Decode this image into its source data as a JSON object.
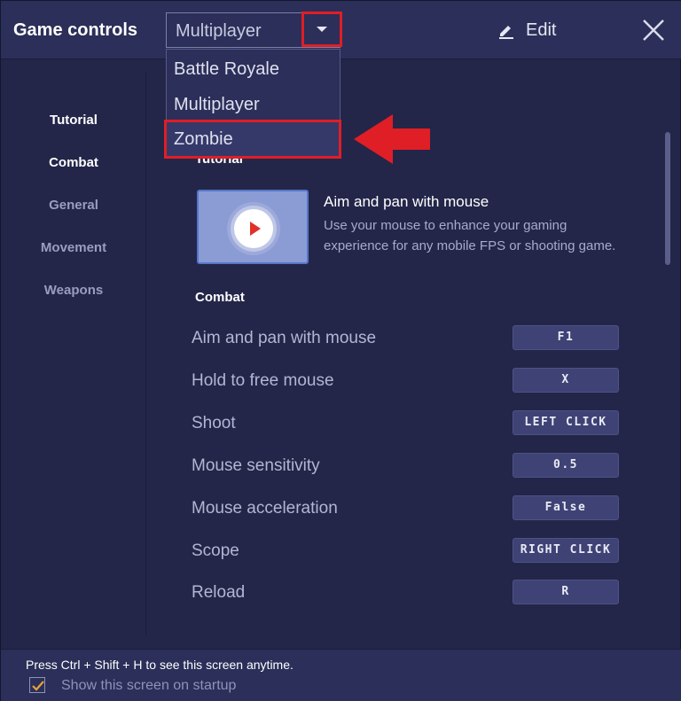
{
  "header": {
    "title": "Game controls",
    "mode_selected": "Multiplayer",
    "edit_label": "Edit"
  },
  "dropdown": {
    "options": [
      "Battle Royale",
      "Multiplayer",
      "Zombie"
    ],
    "highlighted": "Zombie"
  },
  "sidebar": {
    "items": [
      {
        "label": "Tutorial",
        "active": true
      },
      {
        "label": "Combat",
        "active": true
      },
      {
        "label": "General",
        "active": false
      },
      {
        "label": "Movement",
        "active": false
      },
      {
        "label": "Weapons",
        "active": false
      }
    ]
  },
  "tutorial": {
    "heading": "Tutorial",
    "card_title": "Aim and pan with mouse",
    "card_desc": "Use your mouse to enhance your gaming experience for any mobile FPS or shooting game."
  },
  "combat": {
    "heading": "Combat",
    "controls": [
      {
        "label": "Aim and pan with mouse",
        "key": "F1"
      },
      {
        "label": "Hold to free mouse",
        "key": "X"
      },
      {
        "label": "Shoot",
        "key": "LEFT CLICK"
      },
      {
        "label": "Mouse sensitivity",
        "key": "0.5"
      },
      {
        "label": "Mouse acceleration",
        "key": "False"
      },
      {
        "label": "Scope",
        "key": "RIGHT CLICK"
      },
      {
        "label": "Reload",
        "key": "R"
      }
    ]
  },
  "footer": {
    "hint": "Press Ctrl + Shift + H to see this screen anytime.",
    "startup_label": "Show this screen on startup",
    "startup_checked": true
  },
  "colors": {
    "background": "#232649",
    "panel": "#2b2f59",
    "highlight_red": "#e01e25",
    "checkbox_check": "#e8a33a"
  }
}
